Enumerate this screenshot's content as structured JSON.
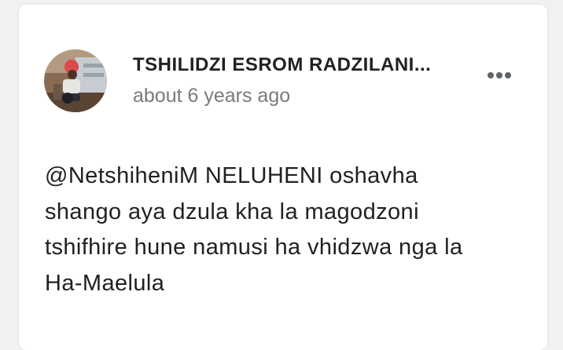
{
  "comment": {
    "author": "TSHILIDZI ESROM RADZILANI...",
    "timestamp": "about 6 years ago",
    "body_lines": [
      "@NetshiheniM NELUHENI oshavha",
      "shango aya dzula kha la magodzoni",
      "tshifhire hune namusi ha vhidzwa nga la",
      "Ha-Maelula"
    ],
    "more_icon": "more-horizontal-icon"
  },
  "colors": {
    "background": "#f1f1f3",
    "card": "#ffffff",
    "text_primary": "#202124",
    "text_secondary": "#7a7a7a",
    "icon": "#5f6368"
  }
}
